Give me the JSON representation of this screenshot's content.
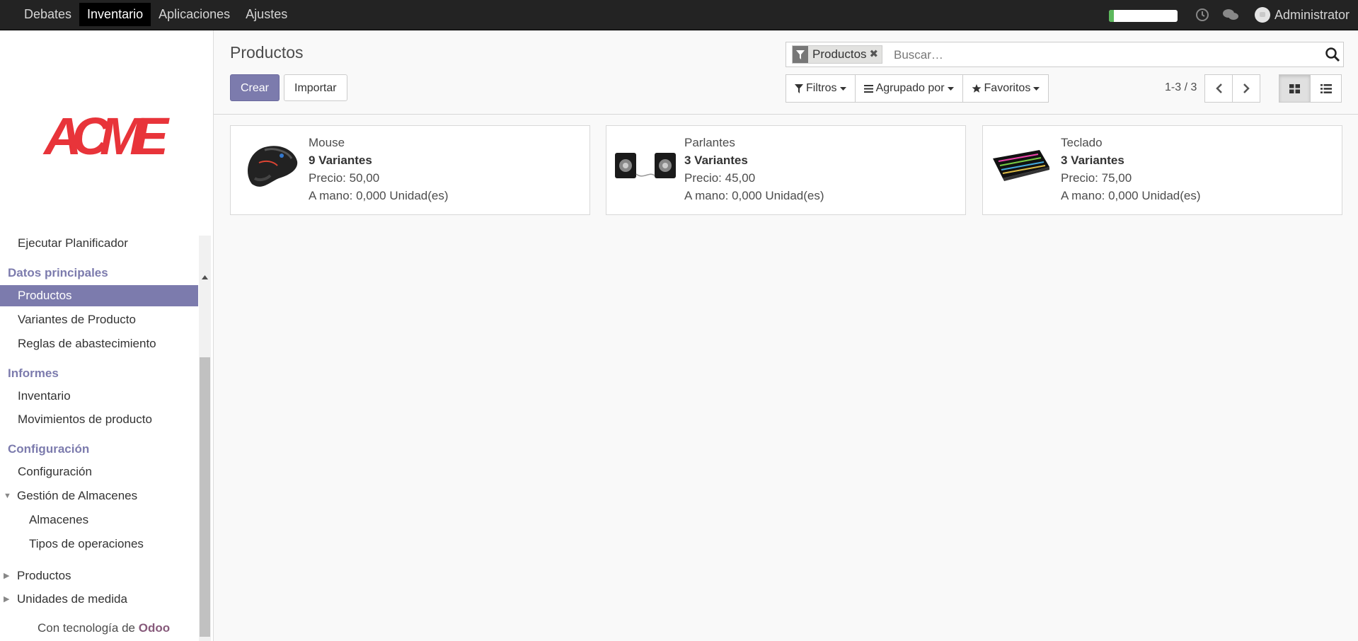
{
  "topbar": {
    "menu": [
      {
        "label": "Debates",
        "active": false
      },
      {
        "label": "Inventario",
        "active": true
      },
      {
        "label": "Aplicaciones",
        "active": false
      },
      {
        "label": "Ajustes",
        "active": false
      }
    ],
    "progress_fraction": 0.07,
    "progress_color": "#5cb85c",
    "icons": [
      "clock-icon",
      "chat-icon"
    ],
    "user_name": "Administrator"
  },
  "sidebar": {
    "logo_text": "ACME",
    "logo_color": "#e8343a",
    "items": {
      "scheduler": "Ejecutar Planificador",
      "header_master": "Datos principales",
      "products": "Productos",
      "variants": "Variantes de Producto",
      "rules": "Reglas de abastecimiento",
      "header_reports": "Informes",
      "inventory": "Inventario",
      "moves": "Movimientos de producto",
      "header_config": "Configuración",
      "config": "Configuración",
      "warehouse_mgmt": "Gestión de Almacenes",
      "warehouses": "Almacenes",
      "op_types": "Tipos de operaciones",
      "products_group": "Productos",
      "uom": "Unidades de medida"
    },
    "powered_prefix": "Con tecnología de",
    "powered_brand": "Odoo",
    "accent_color": "#7c7bad"
  },
  "control_panel": {
    "title": "Productos",
    "create_label": "Crear",
    "import_label": "Importar",
    "search": {
      "facet_label": "Productos",
      "placeholder": "Buscar…"
    },
    "filters_label": "Filtros",
    "group_by_label": "Agrupado por",
    "favorites_label": "Favoritos",
    "pager": "1-3 / 3"
  },
  "products": [
    {
      "name": "Mouse",
      "variants": "9 Variantes",
      "price": "Precio: 50,00",
      "on_hand": "A mano: 0,000 Unidad(es)"
    },
    {
      "name": "Parlantes",
      "variants": "3 Variantes",
      "price": "Precio: 45,00",
      "on_hand": "A mano: 0,000 Unidad(es)"
    },
    {
      "name": "Teclado",
      "variants": "3 Variantes",
      "price": "Precio: 75,00",
      "on_hand": "A mano: 0,000 Unidad(es)"
    }
  ]
}
